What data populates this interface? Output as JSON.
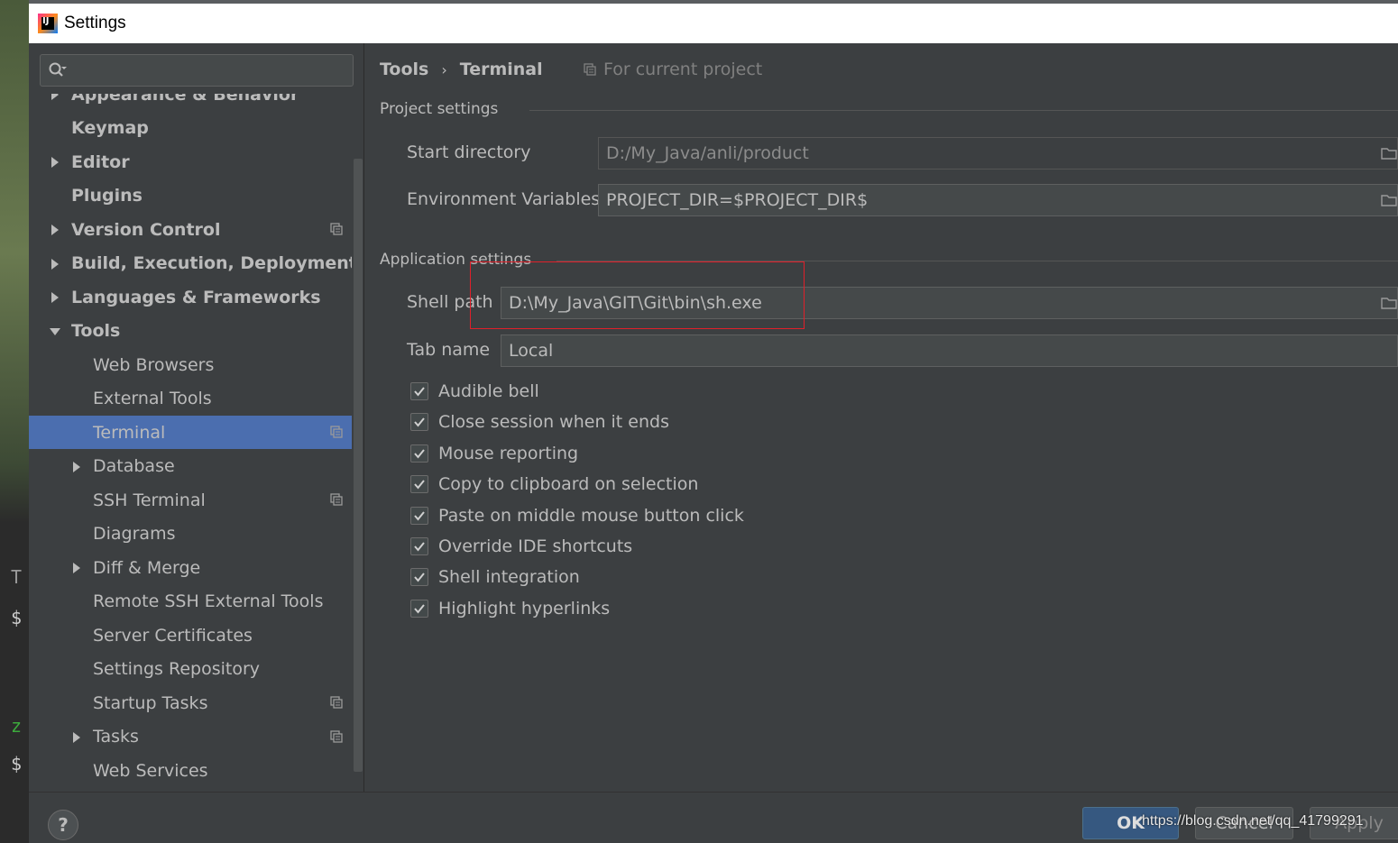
{
  "window": {
    "title": "Settings"
  },
  "search": {
    "placeholder": ""
  },
  "tree": {
    "items": [
      {
        "label": "Appearance & Behavior",
        "bold": true,
        "arrow": "right",
        "indent": 0,
        "partial": true
      },
      {
        "label": "Keymap",
        "bold": true,
        "arrow": "",
        "indent": 0
      },
      {
        "label": "Editor",
        "bold": true,
        "arrow": "right",
        "indent": 0
      },
      {
        "label": "Plugins",
        "bold": true,
        "arrow": "",
        "indent": 0
      },
      {
        "label": "Version Control",
        "bold": true,
        "arrow": "right",
        "indent": 0,
        "project_icon": true
      },
      {
        "label": "Build, Execution, Deployment",
        "bold": true,
        "arrow": "right",
        "indent": 0
      },
      {
        "label": "Languages & Frameworks",
        "bold": true,
        "arrow": "right",
        "indent": 0
      },
      {
        "label": "Tools",
        "bold": true,
        "arrow": "down",
        "indent": 0
      },
      {
        "label": "Web Browsers",
        "bold": false,
        "arrow": "",
        "indent": 1
      },
      {
        "label": "External Tools",
        "bold": false,
        "arrow": "",
        "indent": 1
      },
      {
        "label": "Terminal",
        "bold": false,
        "arrow": "",
        "indent": 1,
        "selected": true,
        "project_icon": true
      },
      {
        "label": "Database",
        "bold": false,
        "arrow": "right",
        "indent": 1
      },
      {
        "label": "SSH Terminal",
        "bold": false,
        "arrow": "",
        "indent": 1,
        "project_icon": true
      },
      {
        "label": "Diagrams",
        "bold": false,
        "arrow": "",
        "indent": 1
      },
      {
        "label": "Diff & Merge",
        "bold": false,
        "arrow": "right",
        "indent": 1
      },
      {
        "label": "Remote SSH External Tools",
        "bold": false,
        "arrow": "",
        "indent": 1
      },
      {
        "label": "Server Certificates",
        "bold": false,
        "arrow": "",
        "indent": 1
      },
      {
        "label": "Settings Repository",
        "bold": false,
        "arrow": "",
        "indent": 1
      },
      {
        "label": "Startup Tasks",
        "bold": false,
        "arrow": "",
        "indent": 1,
        "project_icon": true
      },
      {
        "label": "Tasks",
        "bold": false,
        "arrow": "right",
        "indent": 1,
        "project_icon": true
      },
      {
        "label": "Web Services",
        "bold": false,
        "arrow": "",
        "indent": 1
      }
    ]
  },
  "breadcrumb": {
    "parent": "Tools",
    "separator": "›",
    "current": "Terminal"
  },
  "for_project": "For current project",
  "project_settings": {
    "title": "Project settings",
    "start_directory_label": "Start directory",
    "start_directory_value": "D:/My_Java/anli/product",
    "env_vars_label": "Environment Variables",
    "env_vars_value": "PROJECT_DIR=$PROJECT_DIR$"
  },
  "application_settings": {
    "title": "Application settings",
    "shell_path_label": "Shell path",
    "shell_path_value": "D:\\My_Java\\GIT\\Git\\bin\\sh.exe",
    "tab_name_label": "Tab name",
    "tab_name_value": "Local"
  },
  "checkboxes": [
    {
      "label": "Audible bell",
      "checked": true
    },
    {
      "label": "Close session when it ends",
      "checked": true
    },
    {
      "label": "Mouse reporting",
      "checked": true
    },
    {
      "label": "Copy to clipboard on selection",
      "checked": true
    },
    {
      "label": "Paste on middle mouse button click",
      "checked": true
    },
    {
      "label": "Override IDE shortcuts",
      "checked": true
    },
    {
      "label": "Shell integration",
      "checked": true
    },
    {
      "label": "Highlight hyperlinks",
      "checked": true
    }
  ],
  "buttons": {
    "help": "?",
    "ok": "OK",
    "cancel": "Cancel",
    "apply": "Apply"
  },
  "watermark": "https://blog.csdn.net/qq_41799291",
  "colors": {
    "selection": "#4b6eaf",
    "highlight_box": "#e0202a",
    "ok_button": "#365880"
  }
}
